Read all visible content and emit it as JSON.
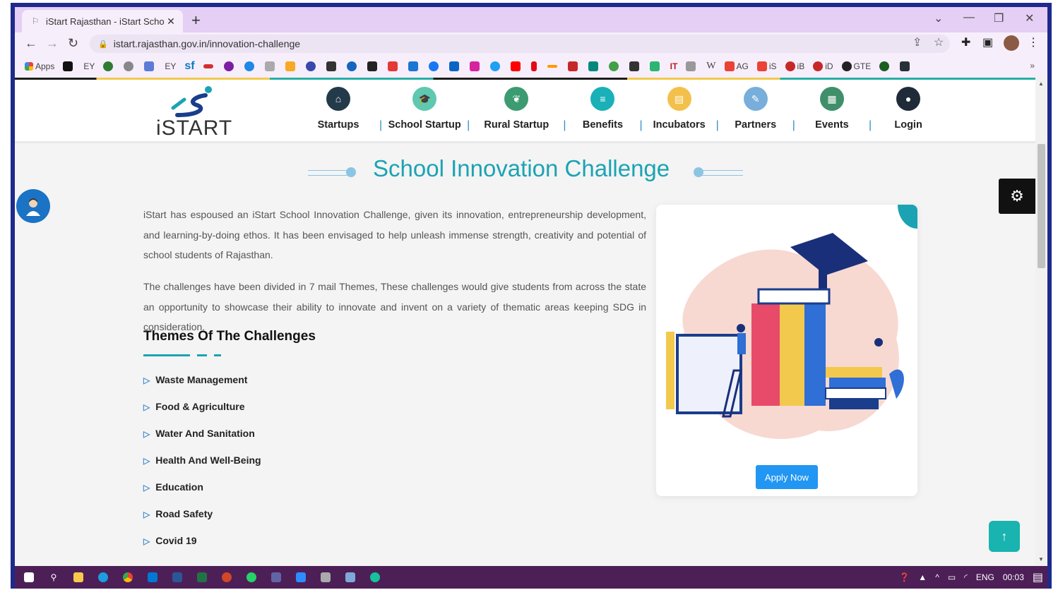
{
  "browser": {
    "tab_title": "iStart Rajasthan - iStart School In",
    "new_tab": "+",
    "url": "istart.rajasthan.gov.in/innovation-challenge",
    "win_min": "—",
    "win_restore": "❐",
    "win_close": "✕",
    "chevron": "⌄"
  },
  "bookmarks": {
    "apps_label": "Apps",
    "items": [
      "EY",
      "EY",
      "sf",
      "AG",
      "iS",
      "iB",
      "iD",
      "GTE",
      "IT",
      "W"
    ],
    "more": "»"
  },
  "nav": {
    "logo_text": "iSTART",
    "items": [
      {
        "label": "Startups",
        "icon": "home-icon",
        "color": "#223a4a",
        "glyph": "⌂"
      },
      {
        "label": "School Startup",
        "icon": "graduation-cap-icon",
        "color": "#5fc8b0",
        "glyph": "🎓"
      },
      {
        "label": "Rural Startup",
        "icon": "leaf-icon",
        "color": "#3c9b71",
        "glyph": "❦"
      },
      {
        "label": "Benefits",
        "icon": "list-icon",
        "color": "#1ab0b8",
        "glyph": "≡"
      },
      {
        "label": "Incubators",
        "icon": "document-icon",
        "color": "#f3c14b",
        "glyph": "▤"
      },
      {
        "label": "Partners",
        "icon": "edit-icon",
        "color": "#78aedb",
        "glyph": "✎"
      },
      {
        "label": "Events",
        "icon": "calendar-icon",
        "color": "#3f8f6a",
        "glyph": "▦"
      },
      {
        "label": "Login",
        "icon": "user-icon",
        "color": "#1f2b38",
        "glyph": "●"
      }
    ],
    "separator": "|"
  },
  "page": {
    "title": "School Innovation Challenge",
    "paragraph1": "iStart has espoused an iStart School Innovation Challenge, given its innovation, entrepreneurship development, and learning-by-doing ethos. It has been envisaged to help unleash immense strength, creativity and potential of school students of Rajasthan.",
    "paragraph2": "The challenges have been divided in 7 mail Themes, These challenges would give students from across the state an opportunity to showcase their ability to innovate and invent on a variety of thematic areas keeping SDG in consideration.",
    "themes_heading": "Themes Of The Challenges",
    "themes": [
      "Waste Management",
      "Food & Agriculture",
      "Water And Sanitation",
      "Health And Well-Being",
      "Education",
      "Road Safety",
      "Covid 19"
    ],
    "apply_label": "Apply Now",
    "settings_icon": "gear-icon",
    "back_to_top_icon": "arrow-up-icon",
    "accent": "#1ba3b4"
  },
  "taskbar": {
    "lang": "ENG",
    "time": "00:03"
  }
}
